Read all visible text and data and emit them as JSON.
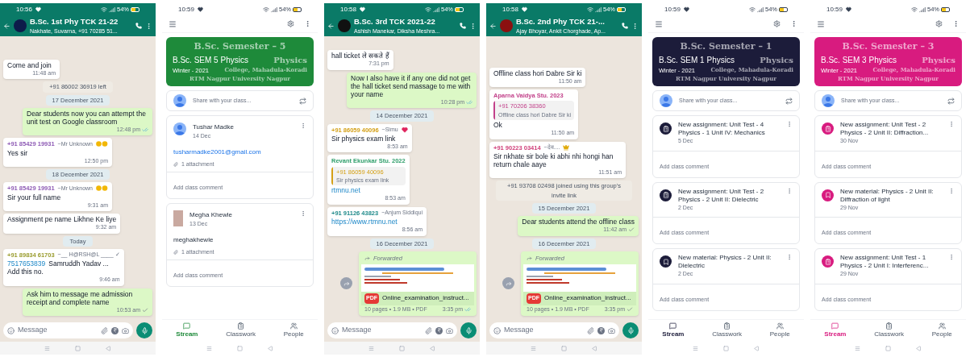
{
  "screens": [
    {
      "kind": "chat",
      "status": {
        "time": "10:56",
        "battery": "54%"
      },
      "title": "B.Sc. 1st Phy TCK 21-22",
      "subtitle": "Nakhate, Suvarna, +91 70285 51...",
      "color": "#0d1b4a",
      "input_placeholder": "Message",
      "messages": [
        {
          "kind": "in",
          "text": "Come and join",
          "time": "11:48 am"
        },
        {
          "kind": "system",
          "text": "+91 86002 36919 left"
        },
        {
          "kind": "date",
          "text": "17 December 2021"
        },
        {
          "kind": "out",
          "text": "Dear students now you can attempt the unit test on Google classroom",
          "time": "12:48 pm",
          "double_tick": true
        },
        {
          "kind": "in",
          "sender": "+91 85429 19931",
          "color": "#8e5bb5",
          "note": {
            "text": "~Mr Unknown",
            "kind": "sad"
          },
          "text": "Yes sir",
          "time": "12:50 pm"
        },
        {
          "kind": "date",
          "text": "18 December 2021"
        },
        {
          "kind": "in",
          "sender": "+91 85429 19931",
          "color": "#8e5bb5",
          "note": {
            "text": "~Mr Unknown",
            "kind": "sad"
          },
          "text": "Sir your full name",
          "time": "9:31 am"
        },
        {
          "kind": "in",
          "text": "Assignment pe name Likhne Ke liye",
          "time": "9:32 am"
        },
        {
          "kind": "date",
          "text": "Today"
        },
        {
          "kind": "in",
          "sender": "+91 89834 61703",
          "color": "#9a9c2e",
          "note": {
            "text": "~__ H@RSH@L ____ ✓",
            "kind": "plain"
          },
          "link": "7517653839",
          "text": "Samruddh Yadav ...",
          "text_2": "Add this no.",
          "time": "9:46 am"
        },
        {
          "kind": "out",
          "text": "Ask him to message me admission receipt and complete name",
          "time": "10:53 am",
          "double_tick": false
        }
      ]
    },
    {
      "kind": "classroom",
      "status": {
        "time": "10:59",
        "battery": "54%"
      },
      "color": "#1e8a3a",
      "watermark": [
        "B.Sc. Semester – 5",
        "Physics",
        "College, Mahadula-Koradi",
        "RTM Nagpur University Nagpur"
      ],
      "title": "B.Sc. SEM 5 Physics",
      "subtitle": "Winter - 2021",
      "share_placeholder": "Share with your class...",
      "posts": [
        {
          "kind": "person",
          "photo": false,
          "author": "Tushar Madke",
          "date": "14 Dec",
          "body": "tusharmadke2001@gmail.com",
          "body_link": true,
          "attachment": "1 attachment",
          "comment": "Add class comment"
        },
        {
          "kind": "person",
          "photo": true,
          "author": "Megha Khewle",
          "date": "13 Dec",
          "body": "meghakhewle",
          "body_link": false,
          "attachment": "1 attachment",
          "comment": "Add class comment"
        }
      ],
      "nav": [
        {
          "label": "Stream",
          "selected": true
        },
        {
          "label": "Classwork",
          "selected": false
        },
        {
          "label": "People",
          "selected": false
        }
      ]
    },
    {
      "kind": "chat",
      "status": {
        "time": "10:58",
        "battery": "54%"
      },
      "title": "B.Sc. 3rd TCK 2021-22",
      "subtitle": "Ashish Manekar, Diksha Meshra...",
      "color": "#111111",
      "input_placeholder": "Message",
      "messages": [
        {
          "kind": "in",
          "text": "hall ticket ले सकते हैं",
          "time": "7:31 pm"
        },
        {
          "kind": "out",
          "text": "Now I also have it if any one did not get the hall ticket send massage to me with your name",
          "time": "10:28 pm",
          "double_tick": true
        },
        {
          "kind": "date",
          "text": "14 December 2021"
        },
        {
          "kind": "in",
          "sender": "+91 86059 40096",
          "color": "#d4a017",
          "note": {
            "text": "~Simu",
            "kind": "heart"
          },
          "text": "Sir physics exam link",
          "time": "8:53 am"
        },
        {
          "kind": "in",
          "sender": "Revant Ekunkar Stu. 2022",
          "color": "#2e9e6a",
          "quote": {
            "sender": "+91 86059 40096",
            "color": "#d4a017",
            "text": "Sir physics exam link"
          },
          "link": "rtmnu.net",
          "time": "8:53 am"
        },
        {
          "kind": "in",
          "sender": "+91 91126 43823",
          "color": "#1f8a8a",
          "note": {
            "text": "~Anjum Siddiqui",
            "kind": "plain"
          },
          "link": "https://www.rtmnu.net",
          "time": "8:56 am"
        },
        {
          "kind": "date",
          "text": "16 December 2021"
        },
        {
          "kind": "file",
          "label": "Forwarded",
          "icon_label": "PDF",
          "name": "Online_examination_instruct...",
          "meta": "10 pages • 1.9 MB • PDF",
          "time": "3:35 pm",
          "double_tick": true
        }
      ]
    },
    {
      "kind": "chat",
      "status": {
        "time": "10:58",
        "battery": "54%"
      },
      "title": "B.Sc. 2nd Phy TCK 21-...",
      "subtitle": "Ajay Bhoyar, Ankit Chorghade, Ap...",
      "color": "#8b1010",
      "input_placeholder": "Message",
      "messages": [
        {
          "kind": "in",
          "text": "Offline class hori Dabre Sir ki",
          "time": "11:50 am"
        },
        {
          "kind": "in",
          "sender": "Aparna Vaidya Stu. 2023",
          "color": "#c2408a",
          "quote": {
            "sender": "+91 70206 38360",
            "color": "#c2408a",
            "text": "Offline class hori Dabre Sir ki"
          },
          "text": "Ok",
          "time": "11:50 am"
        },
        {
          "kind": "in",
          "sender": "+91 90223 03414",
          "color": "#d0407a",
          "note": {
            "text": "~देव....",
            "kind": "crown"
          },
          "text": "Sir nkhate sir bole ki abhi nhi hongi han return chale aaye",
          "time": "11:51 am"
        },
        {
          "kind": "system",
          "text": "+91 93708 02498 joined using this group's invite link"
        },
        {
          "kind": "date",
          "text": "15 December 2021"
        },
        {
          "kind": "out",
          "text": "Dear students attend the offline class",
          "time": "11:42 am",
          "double_tick": false
        },
        {
          "kind": "date",
          "text": "16 December 2021"
        },
        {
          "kind": "file",
          "label": "Forwarded",
          "icon_label": "PDF",
          "name": "Online_examination_instruct...",
          "meta": "10 pages • 1.9 MB • PDF",
          "time": "3:35 pm",
          "double_tick": false
        }
      ]
    },
    {
      "kind": "classroom",
      "status": {
        "time": "10:59",
        "battery": "54%"
      },
      "color": "#1c1c3a",
      "watermark": [
        "B.Sc. Semester – 1",
        "Physics",
        "College, Mahadula-Koradi",
        "RTM Nagpur University Nagpur"
      ],
      "title": "B.Sc. SEM 1 Physics",
      "subtitle": "Winter - 2021",
      "share_placeholder": "Share with your class...",
      "posts": [
        {
          "kind": "assignment",
          "title": "New assignment: Unit Test - 4 Physics - 1 Unit IV: Mechanics",
          "date": "5 Dec",
          "comment": "Add class comment"
        },
        {
          "kind": "assignment",
          "title": "New assignment: Unit Test - 2 Physics - 2 Unit II: Dielectric",
          "date": "2 Dec",
          "comment": "Add class comment"
        },
        {
          "kind": "material",
          "title": "New material: Physics - 2 Unit II: Dielectric",
          "date": "2 Dec",
          "comment": "Add class comment"
        }
      ],
      "nav": [
        {
          "label": "Stream",
          "selected": true
        },
        {
          "label": "Classwork",
          "selected": false
        },
        {
          "label": "People",
          "selected": false
        }
      ]
    },
    {
      "kind": "classroom",
      "status": {
        "time": "10:59",
        "battery": "54%"
      },
      "color": "#d81b7f",
      "watermark": [
        "B.Sc. Semester – 3",
        "Physics",
        "College, Mahadula-Koradi",
        "RTM Nagpur University Nagpur"
      ],
      "title": "B.Sc. SEM 3 Physics",
      "subtitle": "Winter - 2021",
      "share_placeholder": "Share with your class...",
      "posts": [
        {
          "kind": "assignment",
          "title": "New assignment: Unit Test - 2 Physics - 2 Unit II: Diffraction...",
          "date": "30 Nov",
          "comment": "Add class comment"
        },
        {
          "kind": "material",
          "title": "New material: Physics - 2 Unit II: Diffraction of light",
          "date": "29 Nov",
          "comment": "Add class comment"
        },
        {
          "kind": "assignment",
          "title": "New assignment: Unit Test - 1 Physics - 2 Unit I: Interferenc...",
          "date": "29 Nov",
          "comment": "Add class comment"
        }
      ],
      "nav": [
        {
          "label": "Stream",
          "selected": true
        },
        {
          "label": "Classwork",
          "selected": false
        },
        {
          "label": "People",
          "selected": false
        }
      ]
    }
  ]
}
